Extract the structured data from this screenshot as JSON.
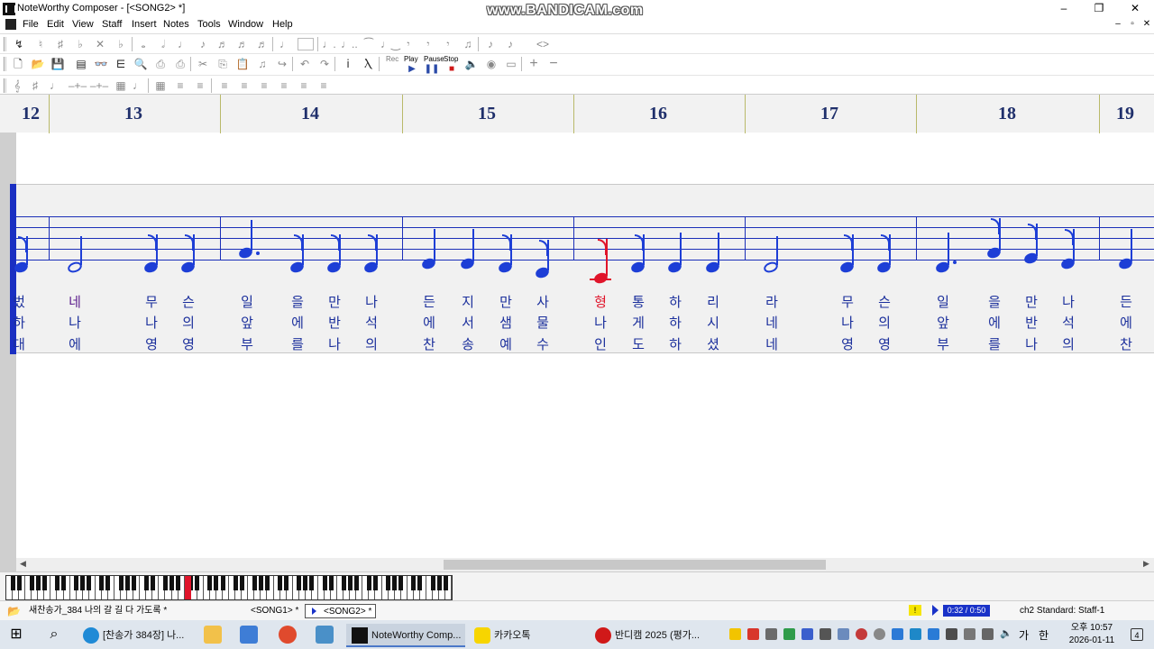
{
  "window": {
    "title": "NoteWorthy Composer - [<SONG2> *]",
    "watermark": "www.BANDICAM.com",
    "controls": {
      "minimize": "–",
      "maximize": "❐",
      "close": "✕"
    }
  },
  "menubar": {
    "items": [
      "File",
      "Edit",
      "View",
      "Staff",
      "Insert",
      "Notes",
      "Tools",
      "Window",
      "Help"
    ],
    "mdi": {
      "minimize": "–",
      "restore": "▫",
      "close": "✕"
    }
  },
  "toolbar": {
    "play_label": "Play",
    "pause_label": "Pause",
    "stop_label": "Stop",
    "rec_label": "Rec"
  },
  "ruler": {
    "measures": [
      "12",
      "13",
      "14",
      "15",
      "16",
      "17",
      "18",
      "19"
    ]
  },
  "lyrics": {
    "verse1": [
      "벘",
      "네",
      "무",
      "슨",
      "일",
      "을",
      "만",
      "나",
      "든",
      "지",
      "만",
      "사",
      "형",
      "통",
      "하",
      "리",
      "라",
      "무",
      "슨",
      "일",
      "을",
      "만",
      "나",
      "든"
    ],
    "verse2": [
      "하",
      "나",
      "나",
      "의",
      "앞",
      "에",
      "반",
      "석",
      "에",
      "서",
      "샘",
      "물",
      "나",
      "게",
      "하",
      "시",
      "네",
      "나",
      "의",
      "앞",
      "에",
      "반",
      "석",
      "에"
    ],
    "verse3": [
      "대",
      "에",
      "영",
      "영",
      "부",
      "를",
      "나",
      "의",
      "찬",
      "송",
      "예",
      "수",
      "인",
      "도",
      "하",
      "셨",
      "네",
      "영",
      "영",
      "부",
      "를",
      "나",
      "의",
      "찬"
    ]
  },
  "tabs": {
    "doc1": "새찬송가_384 나의 갈 길 다 가도록 *",
    "doc2": "<SONG1> *",
    "doc3": "<SONG2> *"
  },
  "status": {
    "warning": "!",
    "time": "0:32 / 0:50",
    "staff": "ch2 Standard: Staff-1"
  },
  "taskbar": {
    "app1": "[찬송가 384장] 나...",
    "app2": "NoteWorthy Comp...",
    "app3": "카카오톡",
    "app4": "반디캠 2025 (평가...",
    "ime1": "가",
    "ime2": "한",
    "clock_period_time": "오후 10:57",
    "clock_date": "2026-01-11",
    "notif_count": "4"
  }
}
